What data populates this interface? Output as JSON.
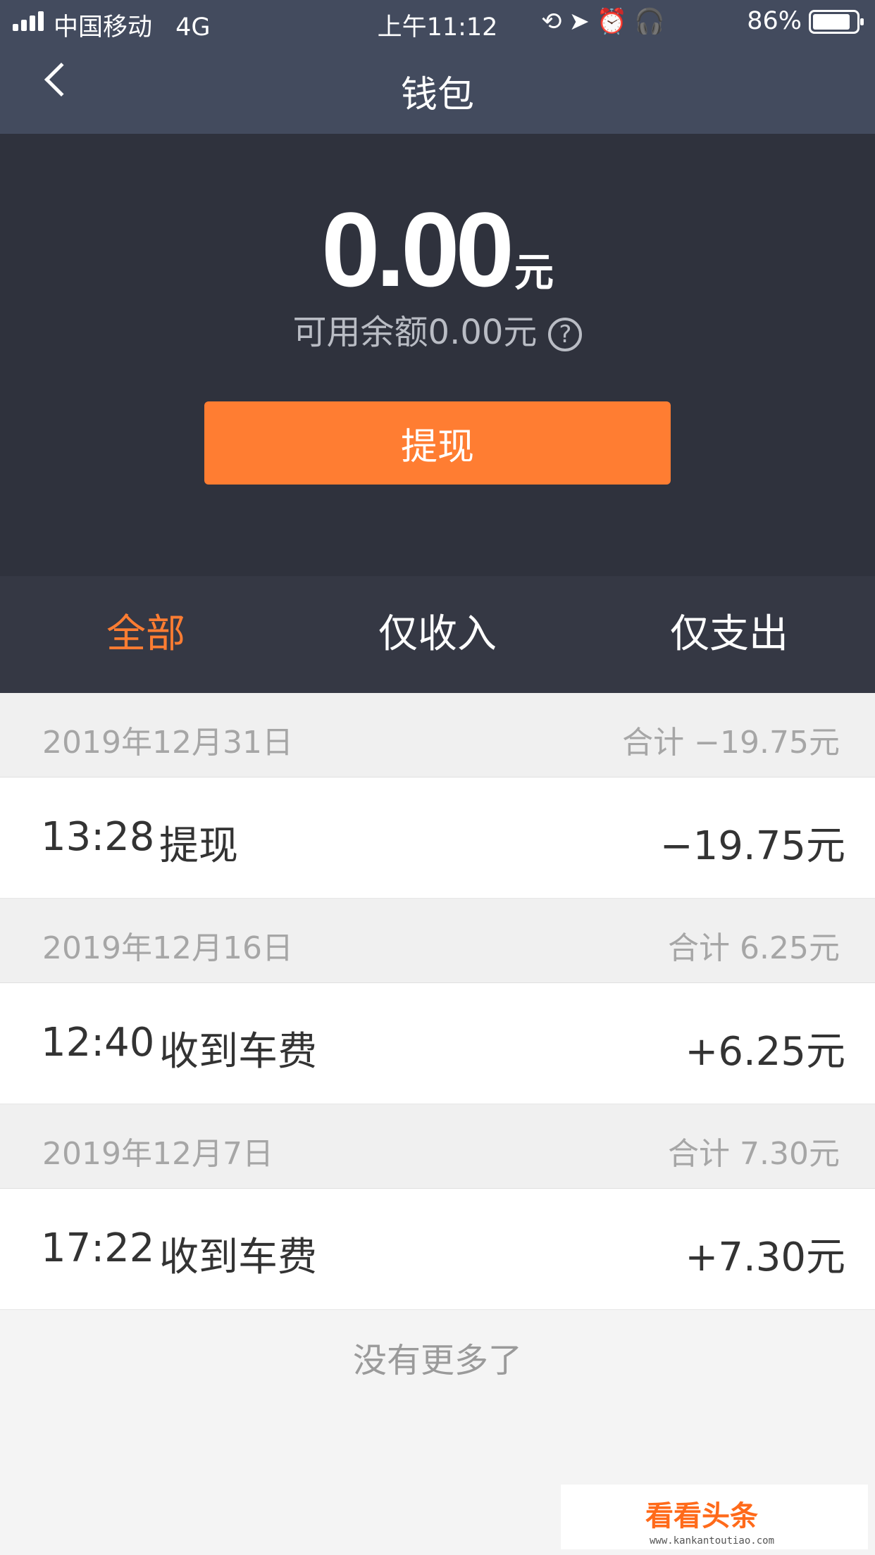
{
  "status_bar": {
    "carrier": "中国移动",
    "network": "4G",
    "time": "上午11:12",
    "icons": [
      "orientation-lock-icon",
      "location-icon",
      "alarm-icon",
      "headphones-icon"
    ],
    "battery_percent": "86%",
    "battery_level": 0.86
  },
  "nav": {
    "back_icon": "chevron-left-icon",
    "title": "钱包"
  },
  "balance": {
    "amount": "0.00",
    "unit": "元",
    "available_text": "可用余额0.00元",
    "help_symbol": "?"
  },
  "withdraw_button": "提现",
  "tabs": [
    {
      "label": "全部",
      "active": true
    },
    {
      "label": "仅收入",
      "active": false
    },
    {
      "label": "仅支出",
      "active": false
    }
  ],
  "groups": [
    {
      "date": "2019年12月31日",
      "total": "合计 −19.75元",
      "items": [
        {
          "time": "13:28",
          "desc": "提现",
          "amount": "−19.75元"
        }
      ]
    },
    {
      "date": "2019年12月16日",
      "total": "合计 6.25元",
      "items": [
        {
          "time": "12:40",
          "desc": "收到车费",
          "amount": "+6.25元"
        }
      ]
    },
    {
      "date": "2019年12月7日",
      "total": "合计 7.30元",
      "items": [
        {
          "time": "17:22",
          "desc": "收到车费",
          "amount": "+7.30元"
        }
      ]
    }
  ],
  "end_note": "没有更多了",
  "watermark": {
    "main": "看看头条",
    "sub": "www.kankantoutiao.com"
  },
  "colors": {
    "accent": "#ff7d32",
    "nav_bg": "#434b5e",
    "panel_bg": "#2f323d",
    "tabs_bg": "#353844"
  }
}
